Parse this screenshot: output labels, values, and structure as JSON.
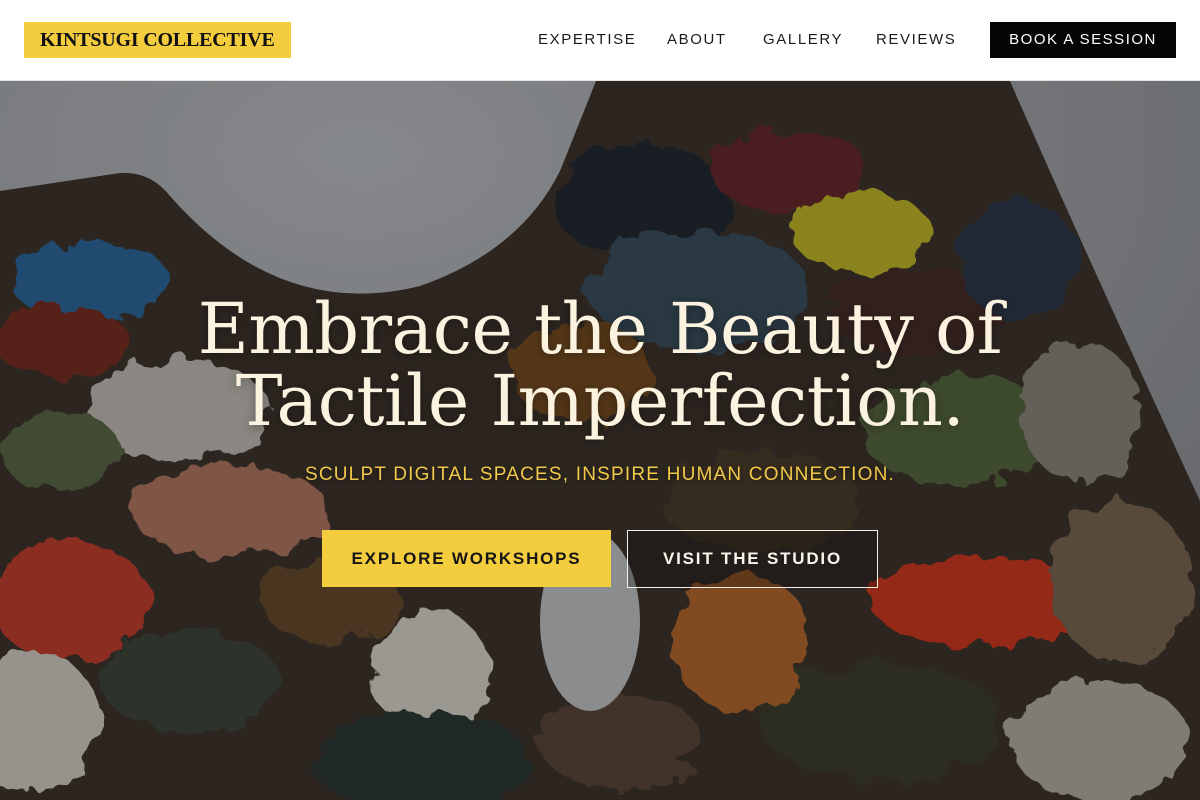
{
  "brand": {
    "name": "KINTSUGI COLLECTIVE",
    "accent": "#f4cd3e"
  },
  "nav": {
    "items": [
      {
        "label": "EXPERTISE"
      },
      {
        "label": "ABOUT"
      },
      {
        "label": "GALLERY"
      },
      {
        "label": "REVIEWS"
      }
    ],
    "cta_label": "BOOK A SESSION"
  },
  "hero": {
    "headline_line1": "Embrace the Beauty of",
    "headline_line2": "Tactile Imperfection.",
    "tagline": "SCULPT DIGITAL SPACES, INSPIRE HUMAN CONNECTION.",
    "primary_cta": "EXPLORE WORKSHOPS",
    "secondary_cta": "VISIT THE STUDIO",
    "background": "paint-palette-photo"
  },
  "colors": {
    "header_bg": "#ffffff",
    "cta_bg": "#050505",
    "headline": "#fbf3df",
    "tagline": "#f1c94a"
  }
}
